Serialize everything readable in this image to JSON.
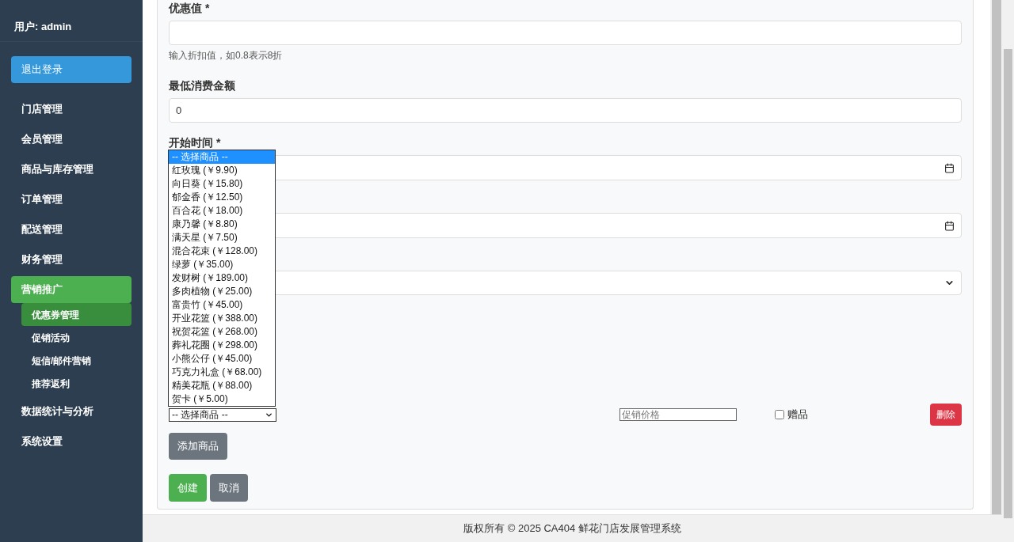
{
  "sidebar": {
    "user": "用户: admin",
    "logout": "退出登录",
    "items": [
      {
        "label": "门店管理",
        "selected": false
      },
      {
        "label": "会员管理",
        "selected": false
      },
      {
        "label": "商品与库存管理",
        "selected": false
      },
      {
        "label": "订单管理",
        "selected": false
      },
      {
        "label": "配送管理",
        "selected": false
      },
      {
        "label": "财务管理",
        "selected": false
      },
      {
        "label": "营销推广",
        "selected": true,
        "children": [
          {
            "label": "优惠券管理",
            "selected": true
          },
          {
            "label": "促销活动",
            "selected": false
          },
          {
            "label": "短信/邮件营销",
            "selected": false
          },
          {
            "label": "推荐返利",
            "selected": false
          }
        ]
      },
      {
        "label": "数据统计与分析",
        "selected": false
      },
      {
        "label": "系统设置",
        "selected": false
      }
    ]
  },
  "form": {
    "fields": [
      {
        "kind": "text",
        "label": "优惠值 *",
        "hint": "输入折扣值，如0.8表示8折"
      },
      {
        "kind": "text",
        "label": "最低消费金额",
        "value": "0"
      },
      {
        "kind": "date",
        "label": "开始时间 *"
      },
      {
        "kind": "date"
      },
      {
        "kind": "select"
      }
    ],
    "product_row": {
      "select": "-- 选择商品 --",
      "price_placeholder": "促销价格",
      "gift_label": "赠品",
      "gift_checked": false,
      "delete": "删除"
    },
    "add_button": "添加商品",
    "buttons": [
      {
        "label": "创建",
        "kind": "primary"
      },
      {
        "label": "取消",
        "kind": "secondary"
      }
    ]
  },
  "dropdown": {
    "options": [
      {
        "label": "-- 选择商品 --",
        "selected": true
      },
      {
        "label": "红玫瑰 (￥9.90)",
        "selected": false
      },
      {
        "label": "向日葵 (￥15.80)",
        "selected": false
      },
      {
        "label": "郁金香 (￥12.50)",
        "selected": false
      },
      {
        "label": "百合花 (￥18.00)",
        "selected": false
      },
      {
        "label": "康乃馨 (￥8.80)",
        "selected": false
      },
      {
        "label": "满天星 (￥7.50)",
        "selected": false
      },
      {
        "label": "混合花束 (￥128.00)",
        "selected": false
      },
      {
        "label": "绿萝 (￥35.00)",
        "selected": false
      },
      {
        "label": "发财树 (￥189.00)",
        "selected": false
      },
      {
        "label": "多肉植物 (￥25.00)",
        "selected": false
      },
      {
        "label": "富贵竹 (￥45.00)",
        "selected": false
      },
      {
        "label": "开业花篮 (￥388.00)",
        "selected": false
      },
      {
        "label": "祝贺花篮 (￥268.00)",
        "selected": false
      },
      {
        "label": "葬礼花圈 (￥298.00)",
        "selected": false
      },
      {
        "label": "小熊公仔 (￥45.00)",
        "selected": false
      },
      {
        "label": "巧克力礼盒 (￥68.00)",
        "selected": false
      },
      {
        "label": "精美花瓶 (￥88.00)",
        "selected": false
      },
      {
        "label": "贺卡 (￥5.00)",
        "selected": false
      }
    ]
  },
  "footer": "版权所有 © 2025 CA404 鲜花门店发展管理系统"
}
